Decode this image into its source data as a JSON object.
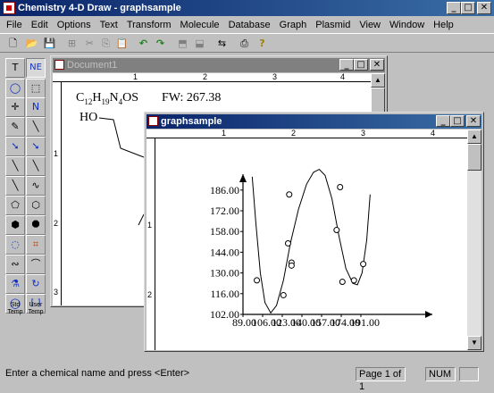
{
  "app": {
    "title": "Chemistry 4-D Draw - graphsample"
  },
  "window_controls": {
    "minimize": "_",
    "maximize": "□",
    "close": "✕"
  },
  "menu": [
    "File",
    "Edit",
    "Options",
    "Text",
    "Transform",
    "Molecule",
    "Database",
    "Graph",
    "Plasmid",
    "View",
    "Window",
    "Help"
  ],
  "toolbar": {
    "icons": [
      "new-icon",
      "open-icon",
      "save-icon",
      "print-preview-icon",
      "cut-icon",
      "copy-icon",
      "paste-icon",
      "undo-icon",
      "redo-icon",
      "tool-a-icon",
      "tool-b-icon",
      "tool-c-icon",
      "print-icon",
      "help-icon"
    ],
    "glyphs": [
      "🗋",
      "📂",
      "💾",
      "⊞",
      "✂",
      "⎘",
      "📋",
      "↶",
      "↷",
      "⬒",
      "⬓",
      "⇆",
      "⎙",
      "?"
    ]
  },
  "palette": {
    "items": [
      {
        "glyph": "T"
      },
      {
        "glyph": "NE"
      },
      {
        "glyph": "◯"
      },
      {
        "glyph": "⬚"
      },
      {
        "glyph": "✛"
      },
      {
        "glyph": "N"
      },
      {
        "glyph": "✎"
      },
      {
        "glyph": "╲"
      },
      {
        "glyph": "➘"
      },
      {
        "glyph": "➘"
      },
      {
        "glyph": "╲"
      },
      {
        "glyph": "╲"
      },
      {
        "glyph": "╲"
      },
      {
        "glyph": "∿"
      },
      {
        "glyph": "⬠"
      },
      {
        "glyph": "⬡"
      },
      {
        "glyph": "⬢"
      },
      {
        "glyph": "⯃"
      },
      {
        "glyph": "◌"
      },
      {
        "glyph": "⌗"
      },
      {
        "glyph": "∾"
      },
      {
        "glyph": "⌒"
      },
      {
        "glyph": "⚗"
      },
      {
        "glyph": "↻"
      },
      {
        "glyph": "◯"
      },
      {
        "glyph": "[ ]"
      }
    ],
    "std_temp": "Std\nTemp",
    "user_temp": "User\nTemp"
  },
  "document1": {
    "title": "Document1",
    "ruler_h": [
      "1",
      "2",
      "3",
      "4"
    ],
    "ruler_v": [
      "1",
      "2",
      "3"
    ],
    "formula_prefix": "C",
    "formula_sub1": "12",
    "formula_h": "H",
    "formula_sub2": "19",
    "formula_n": "N",
    "formula_sub3": "4",
    "formula_os": "OS",
    "fw": "FW: 267.38",
    "ho_label": "HO"
  },
  "graphsample": {
    "title": "graphsample",
    "ruler_h": [
      "1",
      "2",
      "3",
      "4"
    ],
    "ruler_v": [
      "1",
      "2"
    ]
  },
  "chart_data": {
    "type": "scatter",
    "title": "",
    "xlabel": "",
    "ylabel": "",
    "x_ticks": [
      "89.00",
      "106.00",
      "123.00",
      "140.00",
      "157.00",
      "174.00",
      "191.00"
    ],
    "y_ticks": [
      "102.00",
      "116.00",
      "130.00",
      "144.00",
      "158.00",
      "172.00",
      "186.00"
    ],
    "xlim": [
      89,
      208
    ],
    "ylim": [
      102,
      200
    ],
    "points": [
      {
        "x": 101,
        "y": 125
      },
      {
        "x": 124,
        "y": 115
      },
      {
        "x": 128,
        "y": 150
      },
      {
        "x": 129,
        "y": 183
      },
      {
        "x": 131,
        "y": 137
      },
      {
        "x": 131,
        "y": 135
      },
      {
        "x": 170,
        "y": 159
      },
      {
        "x": 173,
        "y": 188
      },
      {
        "x": 175,
        "y": 124
      },
      {
        "x": 185,
        "y": 125
      },
      {
        "x": 193,
        "y": 136
      }
    ],
    "fit_curve": [
      {
        "x": 97,
        "y": 195
      },
      {
        "x": 100,
        "y": 165
      },
      {
        "x": 104,
        "y": 130
      },
      {
        "x": 108,
        "y": 110
      },
      {
        "x": 113,
        "y": 103
      },
      {
        "x": 118,
        "y": 108
      },
      {
        "x": 124,
        "y": 125
      },
      {
        "x": 130,
        "y": 150
      },
      {
        "x": 137,
        "y": 173
      },
      {
        "x": 144,
        "y": 190
      },
      {
        "x": 150,
        "y": 198
      },
      {
        "x": 155,
        "y": 200
      },
      {
        "x": 160,
        "y": 196
      },
      {
        "x": 166,
        "y": 180
      },
      {
        "x": 172,
        "y": 155
      },
      {
        "x": 178,
        "y": 133
      },
      {
        "x": 184,
        "y": 123
      },
      {
        "x": 188,
        "y": 122
      },
      {
        "x": 192,
        "y": 130
      },
      {
        "x": 196,
        "y": 152
      },
      {
        "x": 199,
        "y": 183
      }
    ],
    "grid": false,
    "legend": "none"
  },
  "status": {
    "hint": "Enter a chemical name and press <Enter>",
    "page": "Page 1 of 1",
    "num": "NUM"
  }
}
